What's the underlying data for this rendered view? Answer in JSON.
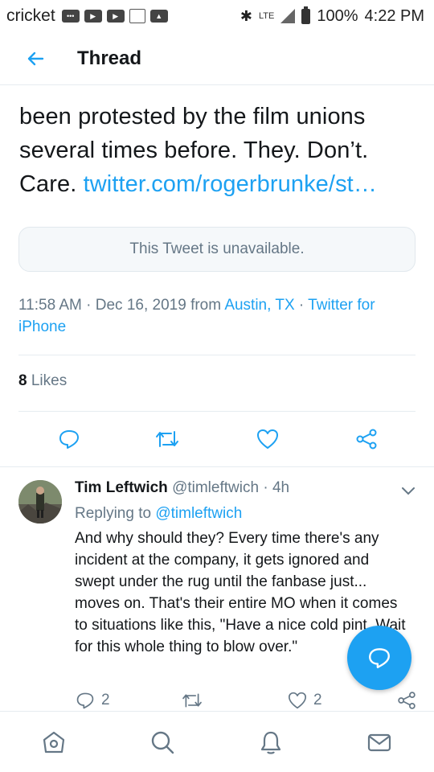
{
  "status_bar": {
    "carrier": "cricket",
    "network": "LTE",
    "battery": "100%",
    "time": "4:22 PM",
    "icons": [
      "message-icon",
      "youtube-icon",
      "youtube-icon",
      "calendar-icon",
      "image-icon",
      "bluetooth-icon",
      "signal-icon",
      "battery-icon"
    ]
  },
  "header": {
    "title": "Thread",
    "back_icon": "back-arrow-icon"
  },
  "tweet": {
    "text_lines": [
      "been protested by the film unions",
      "several times before. They. Don’t.",
      "Care."
    ],
    "link": "twitter.com/rogerbrunke/st…",
    "quoted_unavailable": "This Tweet is unavailable.",
    "time": "11:58 AM",
    "date": "Dec 16, 2019 from",
    "location": "Austin, TX",
    "source": "Twitter for iPhone",
    "likes_count": "8",
    "likes_label": "Likes"
  },
  "reply": {
    "name": "Tim Leftwich",
    "handle": "@timleftwich",
    "time": "4h",
    "replying_label": "Replying to",
    "replying_to": "@timleftwich",
    "text": "And why should they? Every time there's any incident at the company, it gets ignored and swept under the rug until the fanbase just... moves on. That's their entire MO when it comes to situations like this, \"Have a nice cold pint. Wait for this whole thing to blow over.\"",
    "reply_count": "2",
    "like_count": "2"
  },
  "nav": {
    "items": [
      "home-icon",
      "search-icon",
      "notifications-icon",
      "messages-icon"
    ]
  },
  "colors": {
    "accent": "#1da1f2",
    "text": "#14171a",
    "secondary": "#657786"
  }
}
